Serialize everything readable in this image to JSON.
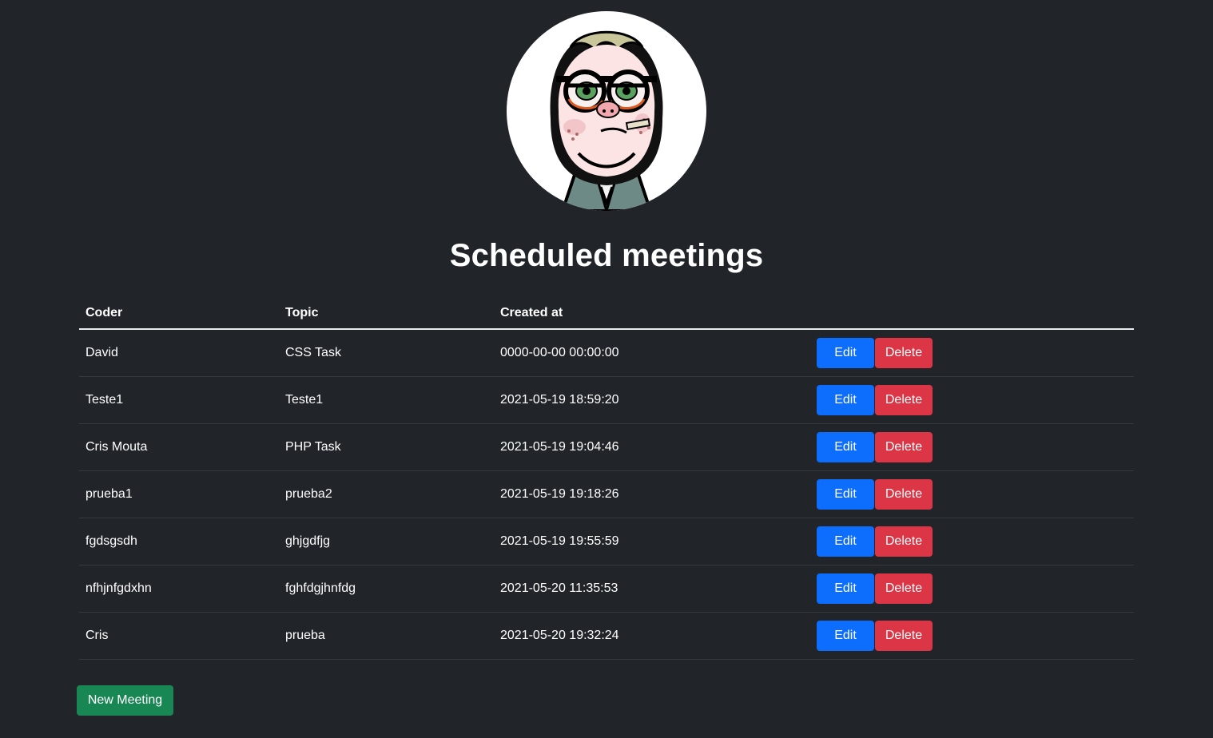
{
  "page": {
    "title": "Scheduled meetings"
  },
  "avatar": {
    "icon": "cartoon-avatar"
  },
  "table": {
    "headers": {
      "coder": "Coder",
      "topic": "Topic",
      "created_at": "Created at"
    },
    "rows": [
      {
        "coder": "David",
        "topic": "CSS Task",
        "created_at": "0000-00-00 00:00:00"
      },
      {
        "coder": "Teste1",
        "topic": "Teste1",
        "created_at": "2021-05-19 18:59:20"
      },
      {
        "coder": "Cris Mouta",
        "topic": "PHP Task",
        "created_at": "2021-05-19 19:04:46"
      },
      {
        "coder": "prueba1",
        "topic": "prueba2",
        "created_at": "2021-05-19 19:18:26"
      },
      {
        "coder": "fgdsgsdh",
        "topic": "ghjgdfjg",
        "created_at": "2021-05-19 19:55:59"
      },
      {
        "coder": "nfhjnfgdxhn",
        "topic": "fghfdgjhnfdg",
        "created_at": "2021-05-20 11:35:53"
      },
      {
        "coder": "Cris",
        "topic": "prueba",
        "created_at": "2021-05-20 19:32:24"
      }
    ],
    "edit_label": "Edit",
    "delete_label": "Delete"
  },
  "actions": {
    "new_meeting_label": "New Meeting"
  },
  "colors": {
    "background": "#212529",
    "edit": "#0d6efd",
    "delete": "#dc3545",
    "new": "#198754"
  }
}
